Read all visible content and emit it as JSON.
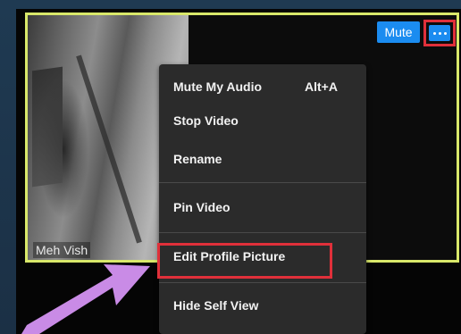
{
  "participant": {
    "name": "Meh Vish"
  },
  "controls": {
    "mute_label": "Mute"
  },
  "menu": {
    "items": [
      {
        "label": "Mute My Audio",
        "shortcut": "Alt+A"
      },
      {
        "label": "Stop Video"
      },
      {
        "label": "Rename"
      },
      {
        "label": "Pin Video"
      },
      {
        "label": "Edit Profile Picture"
      },
      {
        "label": "Hide Self View"
      }
    ]
  },
  "colors": {
    "accent_blue": "#1b8cf0",
    "highlight_red": "#e0303a",
    "tile_border": "#d9e86a",
    "arrow": "#c98be6",
    "menu_bg": "#2b2b2b"
  },
  "icons": {
    "more_options": "more-options-icon",
    "annotation_arrow": "pointer-arrow-icon"
  }
}
